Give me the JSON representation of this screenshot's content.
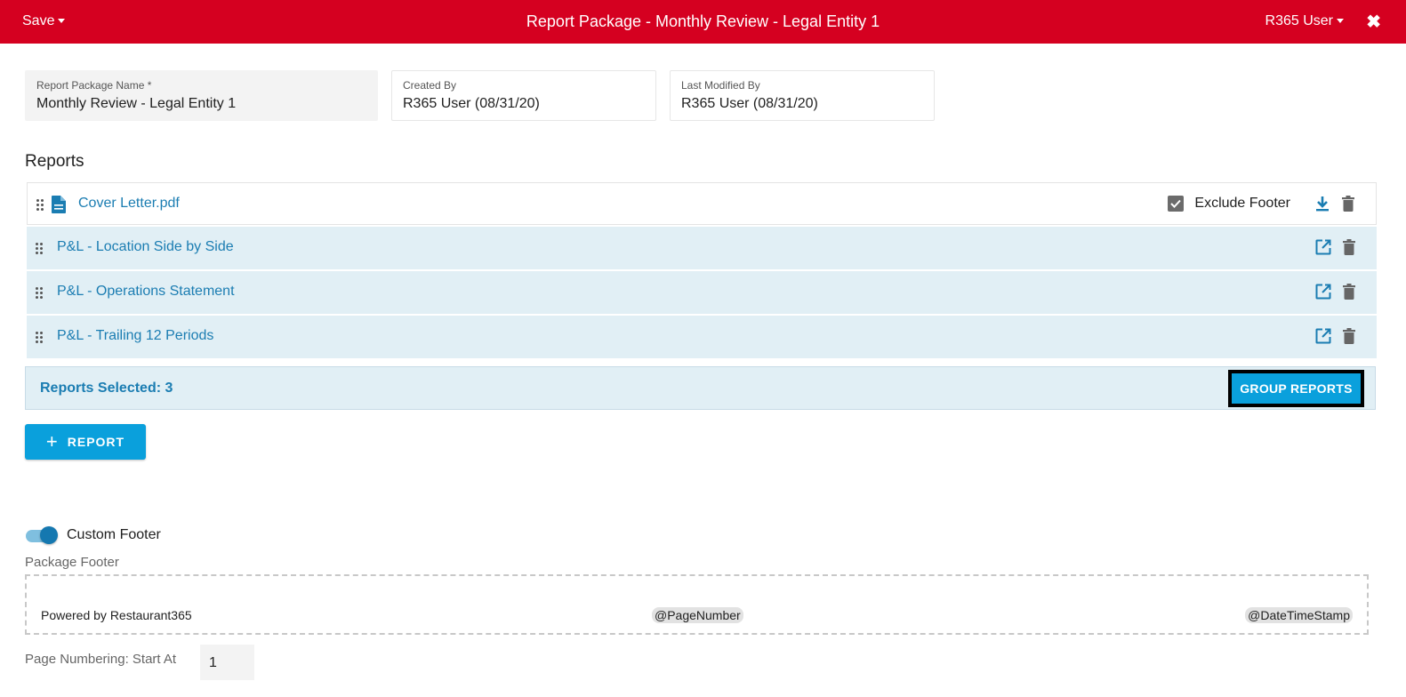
{
  "header": {
    "save_label": "Save",
    "title": "Report Package - Monthly Review - Legal Entity 1",
    "user_label": "R365 User",
    "close_glyph": "✖"
  },
  "fields": {
    "package_name": {
      "label": "Report Package Name *",
      "value": "Monthly Review - Legal Entity 1"
    },
    "created_by": {
      "label": "Created By",
      "value": "R365 User (08/31/20)"
    },
    "modified_by": {
      "label": "Last Modified By",
      "value": "R365 User (08/31/20)"
    }
  },
  "reports": {
    "title": "Reports",
    "items": [
      {
        "name": "Cover Letter.pdf",
        "type": "file",
        "icon": "file-icon",
        "exclude_footer_label": "Exclude Footer",
        "exclude_footer_checked": true
      },
      {
        "name": "P&L - Location Side by Side",
        "type": "report",
        "icon": "open-external-icon"
      },
      {
        "name": "P&L - Operations Statement",
        "type": "report",
        "icon": "open-external-icon"
      },
      {
        "name": "P&L - Trailing 12 Periods",
        "type": "report",
        "icon": "open-external-icon"
      }
    ],
    "selected_text": "Reports Selected: 3",
    "group_button_label": "GROUP REPORTS",
    "add_button_label": "REPORT"
  },
  "footer": {
    "toggle_label": "Custom Footer",
    "toggle_on": true,
    "package_footer_label": "Package Footer",
    "left_text": "Powered by Restaurant365",
    "middle_token": "@PageNumber",
    "right_token": "@DateTimeStamp",
    "page_numbering_label": "Page Numbering: Start At",
    "page_numbering_value": "1"
  },
  "colors": {
    "header_bg": "#d50020",
    "accent": "#0aa0dc",
    "link": "#1b7db2",
    "row_bg": "#e1eff5"
  }
}
